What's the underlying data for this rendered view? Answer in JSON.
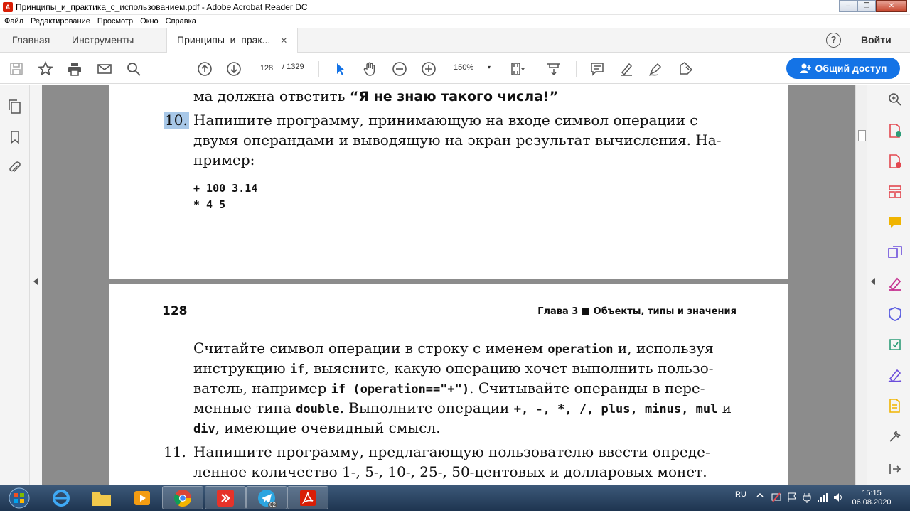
{
  "window": {
    "title": "Принципы_и_практика_с_использованием.pdf - Adobe Acrobat Reader DC",
    "minimize": "–",
    "maximize": "❐",
    "close": "✕"
  },
  "menu": [
    "Файл",
    "Редактирование",
    "Просмотр",
    "Окно",
    "Справка"
  ],
  "tabs": {
    "home": "Главная",
    "tools": "Инструменты",
    "document": "Принципы_и_прак...",
    "close": "✕",
    "help": "?",
    "login": "Войти"
  },
  "toolbar": {
    "page_current": "128",
    "page_total": "/  1329",
    "zoom": "150%",
    "zoom_caret": "▾",
    "share": "Общий доступ"
  },
  "page_top": {
    "line0": "ма должна ответить ",
    "line0_bold": "“Я не знаю такого числа!”",
    "num10": "10.",
    "p10_l1": "Напишите программу, принимающую на входе символ операции с",
    "p10_l2": "двумя операндами и выводящую на экран результат вычисления. На-",
    "p10_l3": "пример:",
    "code1": "+ 100 3.14",
    "code2": "* 4 5"
  },
  "page_bottom": {
    "page_number": "128",
    "chapter": "Глава 3  ■  Объекты, типы и значения",
    "l1a": "Считайте символ операции в строку с именем ",
    "l1_code": "operation",
    "l1b": " и, используя",
    "l2a": "инструкцию ",
    "l2_code": "if",
    "l2b": ", выясните, какую операцию хочет выполнить пользо-",
    "l3a": "ватель, например ",
    "l3_code": "if  (operation==\"+\")",
    "l3b": ". Считывайте операнды в пере-",
    "l4a": "менные типа ",
    "l4_code": "double",
    "l4b": ". Выполните операции ",
    "l4_ops": "+, -, *, /, plus, minus, mul",
    "l4c": " и",
    "l5_code": "div",
    "l5b": ", имеющие очевидный смысл.",
    "num11": "11.",
    "p11_l1": "Напишите программу, предлагающую пользователю ввести опреде-",
    "p11_l2": "ленное количество 1-, 5-, 10-, 25-, 50-центовых и долларовых монет."
  },
  "taskbar": {
    "telegram_badge": "62",
    "lang": "RU",
    "time": "15:15",
    "date": "06.08.2020"
  },
  "colors": {
    "accent": "#1473e6",
    "viewer_bg": "#8c8c8c",
    "highlight": "#a8c8e8"
  }
}
